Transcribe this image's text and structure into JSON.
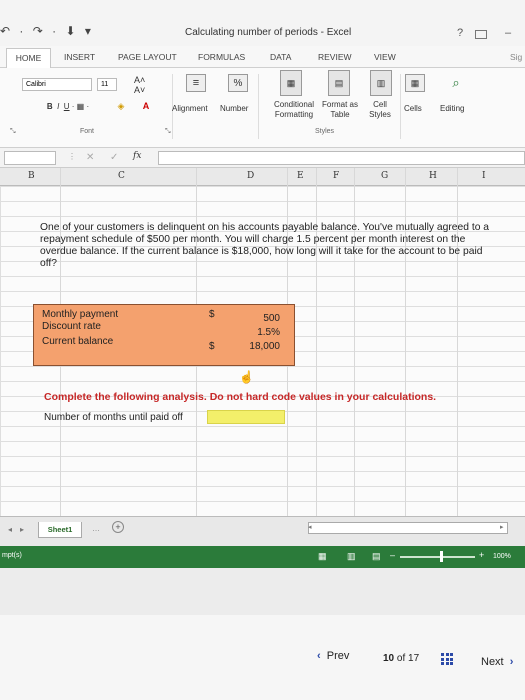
{
  "window": {
    "title": "Calculating number of periods - Excel",
    "help": "?",
    "minimize": "–"
  },
  "tabs": [
    "HOME",
    "INSERT",
    "PAGE LAYOUT",
    "FORMULAS",
    "DATA",
    "REVIEW",
    "VIEW"
  ],
  "signin_partial": "Sig",
  "ribbon": {
    "font_name": "Calibri",
    "font_size": "11",
    "font_group": "Font",
    "alignment": "Alignment",
    "number": "Number",
    "conditional_formatting": "Conditional Formatting",
    "format_as_table": "Format as Table",
    "cell_styles": "Cell Styles",
    "styles_group": "Styles",
    "cells": "Cells",
    "editing": "Editing",
    "percent": "%"
  },
  "formula_bar": {
    "fx": "fx",
    "value": ""
  },
  "columns": [
    "B",
    "C",
    "D",
    "E",
    "F",
    "G",
    "H",
    "I"
  ],
  "problem_text": "One of your customers is delinquent on his accounts payable balance. You've mutually agreed to a repayment schedule of $500 per month. You will charge 1.5 percent per month interest on the overdue balance. If the current balance is $18,000, how long will it take for the account to be paid off?",
  "inputs": [
    {
      "label": "Monthly payment",
      "currency": "$",
      "value": "500"
    },
    {
      "label": "Discount rate",
      "currency": "",
      "value": "1.5%"
    },
    {
      "label": "Current balance",
      "currency": "$",
      "value": "18,000"
    }
  ],
  "instruction": "Complete the following analysis. Do not hard code values in your calculations.",
  "question_label": "Number of months until paid off",
  "answer_value": "",
  "sheet_tab": "Sheet1",
  "status": {
    "left": "mpt(s)",
    "zoom": "100%",
    "zoom_level": 100
  },
  "pager": {
    "prev": "Prev",
    "current": "10",
    "of": "of",
    "total": "17",
    "next": "Next"
  },
  "colors": {
    "input_box": "#f4a16e",
    "answer_cell": "#f3ef6a",
    "instruction": "#c62828",
    "status_bar": "#2b7b3a"
  }
}
